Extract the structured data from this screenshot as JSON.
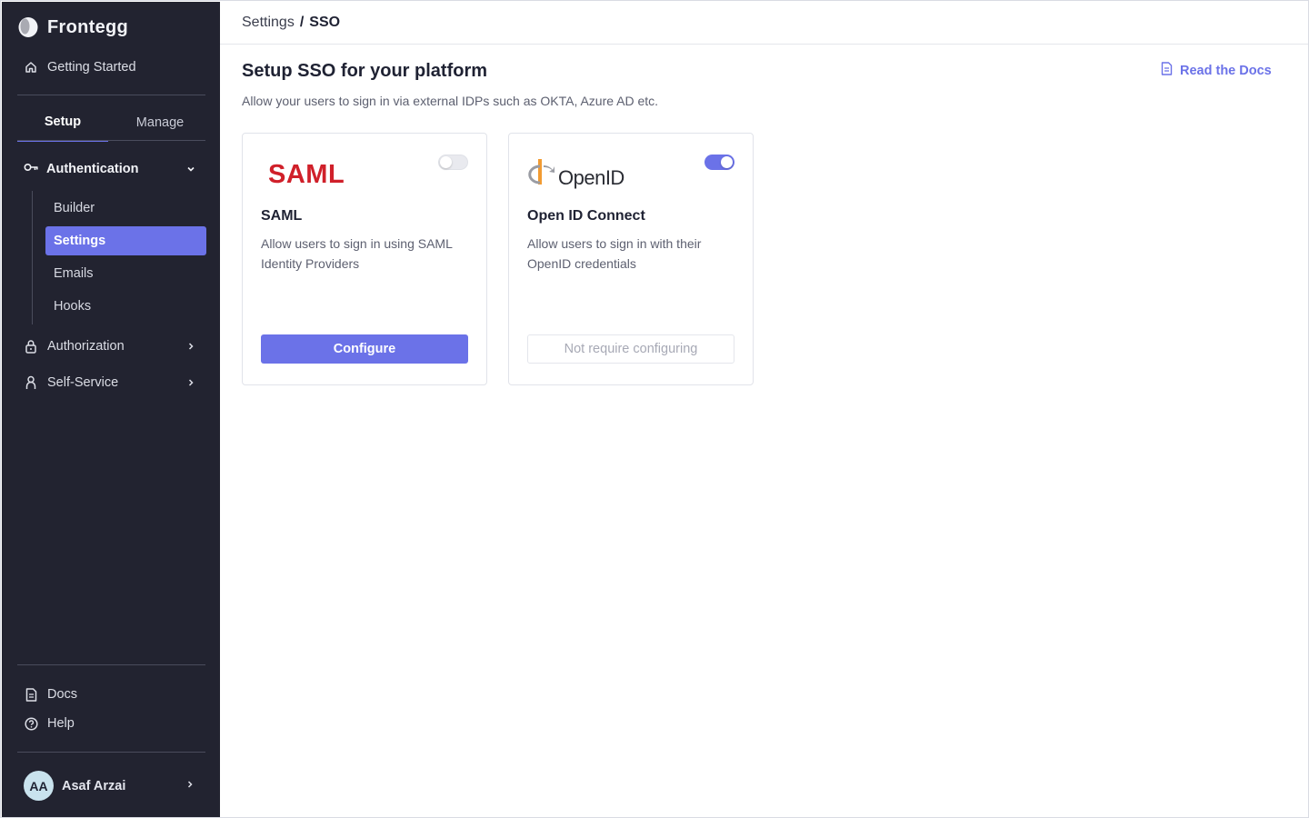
{
  "brand": {
    "name": "Frontegg"
  },
  "sidebar": {
    "getting_started": "Getting Started",
    "tabs": [
      "Setup",
      "Manage"
    ],
    "authentication": {
      "label": "Authentication",
      "items": [
        "Builder",
        "Settings",
        "Emails",
        "Hooks"
      ],
      "active": "Settings"
    },
    "authorization": "Authorization",
    "self_service": "Self-Service",
    "docs": "Docs",
    "help": "Help",
    "user": {
      "initials": "AA",
      "name": "Asaf Arzai"
    }
  },
  "breadcrumb": {
    "parent": "Settings",
    "separator": "/",
    "current": "SSO"
  },
  "page": {
    "title": "Setup SSO for your platform",
    "subtitle": "Allow your users to sign in via external IDPs such as OKTA, Azure AD etc.",
    "docs_link": "Read the Docs"
  },
  "cards": [
    {
      "logo_text": "SAML",
      "title": "SAML",
      "description": "Allow users to sign in using SAML Identity Providers",
      "toggle_on": false,
      "button": "Configure"
    },
    {
      "logo_text": "OpenID",
      "title": "Open ID Connect",
      "description": "Allow users to sign in with their OpenID credentials",
      "toggle_on": true,
      "button": "Not require configuring"
    }
  ],
  "colors": {
    "accent": "#6b72e8",
    "sidebar_bg": "#222330",
    "saml_red": "#d0202a",
    "openid_orange": "#f29b32"
  },
  "icons": [
    "frontegg-logo-icon",
    "home-icon",
    "key-icon",
    "chevron-down-icon",
    "lock-icon",
    "person-icon",
    "chevron-right-icon",
    "document-icon",
    "help-circle-icon"
  ]
}
